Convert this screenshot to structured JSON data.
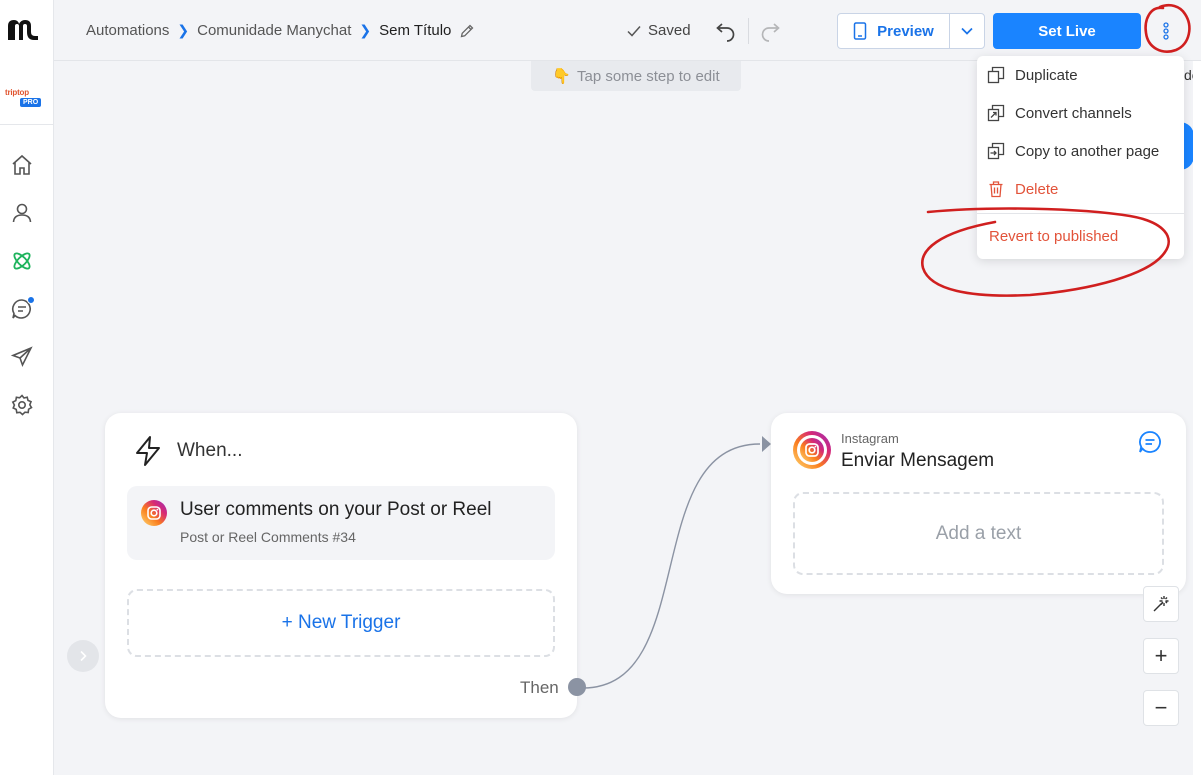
{
  "sidebar": {
    "brand_text": "triptop",
    "brand_badge": "PRO",
    "items": [
      {
        "name": "home-icon"
      },
      {
        "name": "user-icon"
      },
      {
        "name": "automation-icon"
      },
      {
        "name": "chat-icon"
      },
      {
        "name": "send-icon"
      },
      {
        "name": "settings-icon"
      }
    ]
  },
  "header": {
    "breadcrumb": [
      "Automations",
      "Comunidade Manychat",
      "Sem Título"
    ],
    "saved_label": "Saved",
    "preview_label": "Preview",
    "set_live_label": "Set Live"
  },
  "hint": {
    "emoji": "👇",
    "text": "Tap some step to edit"
  },
  "more_menu": {
    "items": [
      {
        "label": "Duplicate",
        "icon": "duplicate-icon"
      },
      {
        "label": "Convert channels",
        "icon": "convert-icon"
      },
      {
        "label": "Copy to another page",
        "icon": "copy-icon"
      },
      {
        "label": "Delete",
        "icon": "trash-icon"
      }
    ],
    "revert_label": "Revert to published"
  },
  "partial_label": "de",
  "trigger_card": {
    "heading": "When...",
    "trigger_title": "User comments on your Post or Reel",
    "trigger_subtitle": "Post or Reel Comments #34",
    "new_trigger_label": "+ New Trigger",
    "then_label": "Then"
  },
  "message_card": {
    "channel": "Instagram",
    "title": "Enviar Mensagem",
    "add_text_label": "Add a text"
  },
  "tools": {
    "zoom_in": "+",
    "zoom_out": "−"
  },
  "colors": {
    "accent": "#1a84ff",
    "link": "#1a73e8",
    "danger": "#e2533a",
    "annotation": "#d01f1f",
    "canvas": "#f3f4f7"
  }
}
